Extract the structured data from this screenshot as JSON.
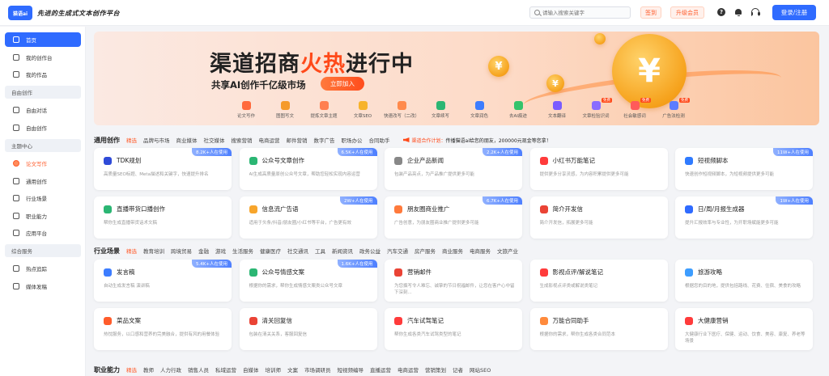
{
  "header": {
    "logo_text": "猫语ai",
    "slogan": "先进的生成式文本创作平台",
    "search_placeholder": "请输入搜索关键字",
    "signin_label": "签到",
    "vip_label": "升级会员",
    "help_label": "?",
    "login_label": "登录/注册"
  },
  "sidebar": {
    "home": "首页",
    "my_workbench": "我的创作台",
    "my_works": "我的作品",
    "group_free": "自由创作",
    "free_chat": "自由对话",
    "free_create": "自由创作",
    "group_theme": "主题中心",
    "essay": "论文写作",
    "general": "通用创作",
    "industry": "行业场景",
    "career": "职业能力",
    "apps": "应用平台",
    "group_overall": "综合服务",
    "hot_trending": "热点追踪",
    "media_pub": "媒体发稿"
  },
  "banner": {
    "title_a": "渠道招商",
    "title_hot": "火热",
    "title_b": "进行中",
    "subtitle": "共享AI创作千亿级市场",
    "join_label": "立即加入",
    "coin_symbol": "¥",
    "free_tag": "免费",
    "icons": [
      {
        "label": "论文写作",
        "color": "#ff6a3d"
      },
      {
        "label": "图图写文",
        "color": "#f59a2b"
      },
      {
        "label": "提炼文章主题",
        "color": "#ff7f50"
      },
      {
        "label": "文章SEO",
        "color": "#f7b32b"
      },
      {
        "label": "快速改写（二改）",
        "color": "#ff8a4c"
      },
      {
        "label": "文章续写",
        "color": "#2bb673"
      },
      {
        "label": "文章润色",
        "color": "#3d7dff"
      },
      {
        "label": "去AI痕迹",
        "color": "#34c36b"
      },
      {
        "label": "文本翻译",
        "color": "#7a5cff"
      },
      {
        "label": "文章检验识词",
        "color": "#8a6cff"
      },
      {
        "label": "社会敏感词",
        "color": "#ff5a5a"
      },
      {
        "label": "广告法检测",
        "color": "#5b7cff"
      }
    ]
  },
  "section1": {
    "title": "通用创作",
    "tabs": [
      "精选",
      "品牌与市场",
      "商业媒体",
      "社交媒体",
      "搜索营销",
      "电商运营",
      "邮件营销",
      "数字广告",
      "职场办公",
      "合同助手"
    ],
    "notice_a": "渠道合作计划：",
    "notice_b": "传播猫语ai给您的朋友，200000元现金等您拿！",
    "cards": [
      {
        "name": "TDK规划",
        "desc": "高质量SEO标题、Meta描述和关键字，快速提升排名",
        "badge": "8.2K+人在使用",
        "color": "#2f4bd8"
      },
      {
        "name": "公众号文章创作",
        "desc": "AI生成高质量原创公众号文章，帮助您轻松实现内容运营",
        "badge": "6.5K+人在使用",
        "color": "#2bb673"
      },
      {
        "name": "企业产品新闻",
        "desc": "包装产品亮点，为产品推广提供更多可能",
        "badge": "2.2K+人在使用",
        "color": "#888888"
      },
      {
        "name": "小红书万能笔记",
        "desc": "提供更多分享灵感，为内容积累提供更多可能",
        "badge": "",
        "color": "#ff3b3b"
      },
      {
        "name": "短视频脚本",
        "desc": "快速创作短视频脚本，为短视频提供更多可能",
        "badge": "11W+人在使用",
        "color": "#2f7bff"
      },
      {
        "name": "直播带货口播创作",
        "desc": "帮你生成直播带货话术文稿",
        "badge": "",
        "color": "#2bb673"
      },
      {
        "name": "信息流广告语",
        "desc": "适用于头条/抖音/朋友圈/小红书等平台，广告更有效",
        "badge": "2W+人在使用",
        "color": "#f7a52b"
      },
      {
        "name": "朋友圈商业推广",
        "desc": "广告创意，为朋友圈商业推广提供更多可能",
        "badge": "6.7K+人在使用",
        "color": "#ff7a3c"
      },
      {
        "name": "简介开发信",
        "desc": "简介开发信，拓展更多可能",
        "badge": "",
        "color": "#ea4335"
      },
      {
        "name": "日/周/月报生成器",
        "desc": "提升汇报效率与专业性，为开职场赋能更多可能",
        "badge": "1W+人在使用",
        "color": "#2f6bff"
      }
    ]
  },
  "section2": {
    "title": "行业场景",
    "tabs": [
      "精选",
      "教育培训",
      "跨境贸易",
      "金融",
      "游戏",
      "生活服务",
      "健康医疗",
      "社交通讯",
      "工具",
      "新闻资讯",
      "政务公益",
      "汽车交通",
      "房产服务",
      "商业服务",
      "电商服务",
      "文旅产业"
    ],
    "cards": [
      {
        "name": "发言稿",
        "desc": "自动生成发言稿 演讲稿",
        "badge": "5.4K+人在使用",
        "color": "#3d7dff"
      },
      {
        "name": "公众号情感文案",
        "desc": "根据你的需求，帮你生成情感文案类公众号文章",
        "badge": "1.6K+人在使用",
        "color": "#2bb673"
      },
      {
        "name": "营销邮件",
        "desc": "为您撰写令人难忘、诚挚的节日祝福邮件，让您在客户心中留下深刻...",
        "badge": "",
        "color": "#ea4335"
      },
      {
        "name": "影视点评/解说笔记",
        "desc": "生成影视点评类或解说类笔记",
        "badge": "",
        "color": "#ff3b3b"
      },
      {
        "name": "旅游攻略",
        "desc": "根据您的目的地，提供包括路线、花费、住宿、美食的攻略",
        "badge": "",
        "color": "#3d9dff"
      },
      {
        "name": "菜品文案",
        "desc": "热忱服务，以口感和营养的完美融合，提供有风的用餐体验",
        "badge": "",
        "color": "#ff5c2b"
      },
      {
        "name": "清关回复信",
        "desc": "包装在清关关系，客服回复信",
        "badge": "",
        "color": "#ea4335"
      },
      {
        "name": "汽车试驾笔记",
        "desc": "帮你生成各类汽车试驾类型的笔记",
        "badge": "",
        "color": "#ff3b3b"
      },
      {
        "name": "万能合同助手",
        "desc": "根据你的需求，帮你生成各类合同范本",
        "badge": "",
        "color": "#ff8a3c"
      },
      {
        "name": "大健康营销",
        "desc": "大健康行业下医疗、保健、运动、饮食、美容、康复、养老等场景",
        "badge": "",
        "color": "#ff3b3b"
      }
    ]
  },
  "section3": {
    "title": "职业能力",
    "tabs": [
      "精选",
      "教师",
      "人力行政",
      "销售人员",
      "私域运营",
      "自媒体",
      "培训师",
      "文案",
      "市场调研员",
      "短视频编导",
      "直播运营",
      "电商运营",
      "营销策划",
      "记者",
      "网站SEO"
    ]
  }
}
